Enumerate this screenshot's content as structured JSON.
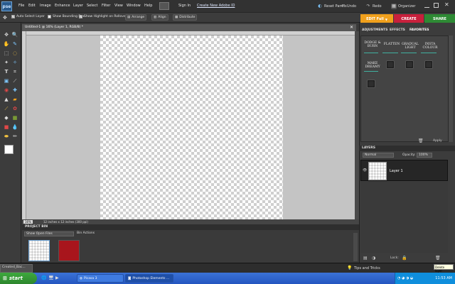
{
  "app": {
    "logo": "pse",
    "menu": [
      "File",
      "Edit",
      "Image",
      "Enhance",
      "Layer",
      "Select",
      "Filter",
      "View",
      "Window",
      "Help"
    ],
    "sign_in": "Sign In",
    "create_id": "Create New Adobe ID",
    "reset_panels": "Reset Panels",
    "undo": "Undo",
    "redo": "Redo",
    "organizer": "Organizer"
  },
  "modes": {
    "edit": "EDIT Full",
    "create": "CREATE",
    "share": "SHARE"
  },
  "options": {
    "auto_select": "Auto Select Layer",
    "bounding_box": "Show Bounding Box",
    "highlight": "Show Highlight on Rollover",
    "arrange": "Arrange",
    "align": "Align",
    "distribute": "Distribute"
  },
  "document": {
    "tab": "Untitled-1 @ 16% (Layer 1, RGB/8) *",
    "zoom": "16%",
    "size": "12 inches x 12 inches (300 ppi)"
  },
  "bin": {
    "title": "PROJECT BIN",
    "select": "Show Open Files",
    "actions": "Bin Actions"
  },
  "panel": {
    "tabs": [
      "ADJUSTMENTS",
      "EFFECTS",
      "FAVORITES"
    ],
    "effects": [
      "DODGE & BURN",
      "FLATTEN",
      "GRADUAL LIGHT",
      "INSTA COLOUR",
      "MAKE DREAMY"
    ],
    "apply": "Apply"
  },
  "layers": {
    "title": "LAYERS",
    "blend": "Normal",
    "opacity_label": "Opacity:",
    "opacity": "100%",
    "layer_name": "Layer 1",
    "lock": "Lock:"
  },
  "help_bar": {
    "tips": "Tips and Tricks",
    "tooltip": "Delete layer"
  },
  "taskbar": {
    "start": "start",
    "tasks": [
      "Picasa 3",
      "Photoshop Elements ..."
    ],
    "minimized": "Created_Bac...",
    "time": "11:53 AM"
  },
  "colors": {
    "edit": "#f0a01c",
    "create": "#c8203c",
    "share": "#2e8a34",
    "accent": "#3fb0a0"
  }
}
